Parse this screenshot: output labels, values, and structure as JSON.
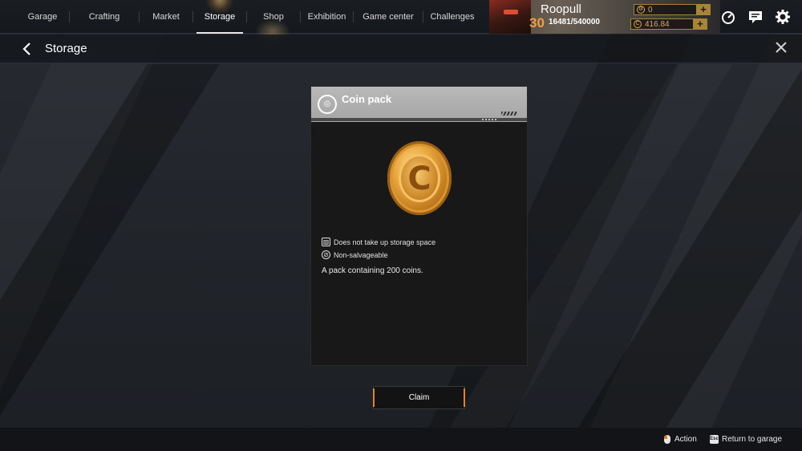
{
  "nav": {
    "items": [
      {
        "label": "Garage"
      },
      {
        "label": "Crafting"
      },
      {
        "label": "Market"
      },
      {
        "label": "Storage",
        "active": true
      },
      {
        "label": "Shop"
      },
      {
        "label": "Exhibition"
      },
      {
        "label": "Game center"
      },
      {
        "label": "Challenges"
      }
    ]
  },
  "profile": {
    "name": "Roopull",
    "level": "30",
    "xp": "16481/540000",
    "currency_1": {
      "value": "0",
      "icon": "gear-coin-icon"
    },
    "currency_2": {
      "value": "416.84",
      "icon": "coin-icon"
    }
  },
  "header": {
    "title": "Storage"
  },
  "item": {
    "title": "Coin pack",
    "icon": "coin-pack-icon",
    "properties": [
      {
        "text": "Does not take up storage space",
        "icon": "no-storage-icon"
      },
      {
        "text": "Non-salvageable",
        "icon": "non-salvageable-icon"
      }
    ],
    "description": "A pack containing 200 coins."
  },
  "actions": {
    "claim_label": "Claim"
  },
  "footer": {
    "action_label": "Action",
    "return_label": "Return to garage",
    "esc_key": "Esc"
  },
  "colors": {
    "accent": "#e0842a",
    "currency_gold": "#d9a855",
    "card_header": "#b0b0b0"
  }
}
